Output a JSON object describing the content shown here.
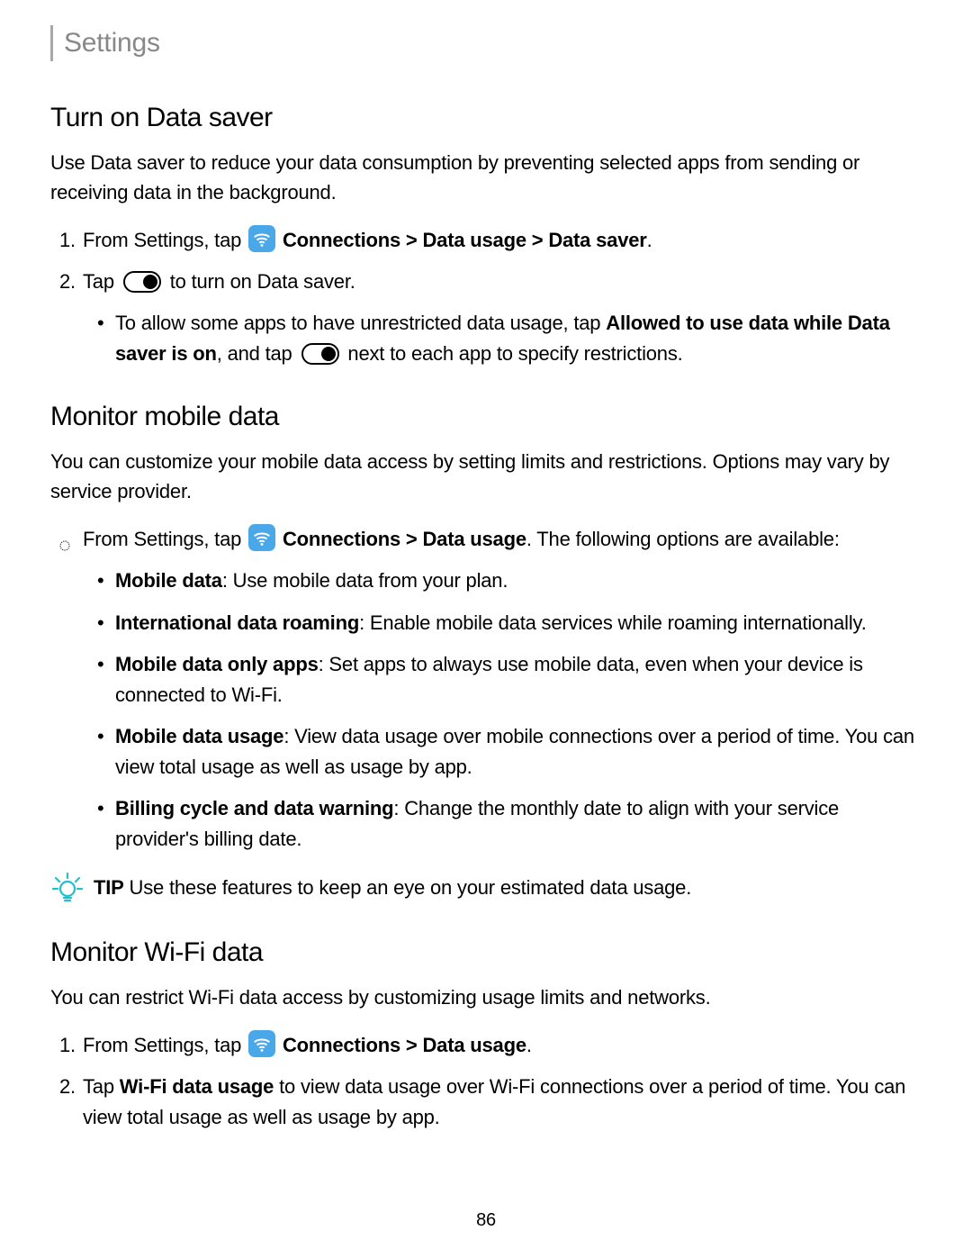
{
  "header": {
    "title": "Settings"
  },
  "page_number": "86",
  "section1": {
    "heading": "Turn on Data saver",
    "intro": "Use Data saver to reduce your data consumption by preventing selected apps from sending or receiving data in the background.",
    "step1_pre": "From Settings, tap ",
    "step1_bold": "Connections > Data usage > Data saver",
    "step1_post": ".",
    "step2_pre": "Tap ",
    "step2_post": " to turn on Data saver.",
    "sub_pre": "To allow some apps to have unrestricted data usage, tap ",
    "sub_bold1": "Allowed to use data while Data saver is on",
    "sub_mid": ", and tap ",
    "sub_end": " next to each app to specify restrictions."
  },
  "section2": {
    "heading": "Monitor mobile data",
    "intro": "You can customize your mobile data access by setting limits and restrictions. Options may vary by service provider.",
    "lead_pre": "From Settings, tap ",
    "lead_bold": "Connections > Data usage",
    "lead_post": ". The following options are available:",
    "opt1_b": "Mobile data",
    "opt1_t": ": Use mobile data from your plan.",
    "opt2_b": "International data roaming",
    "opt2_t": ": Enable mobile data services while roaming internationally.",
    "opt3_b": "Mobile data only apps",
    "opt3_t": ": Set apps to always use mobile data, even when your device is connected to Wi-Fi.",
    "opt4_b": "Mobile data usage",
    "opt4_t": ": View data usage over mobile connections over a period of time. You can view total usage as well as usage by app.",
    "opt5_b": "Billing cycle and data warning",
    "opt5_t": ": Change the monthly date to align with your service provider's billing date.",
    "tip_label": "TIP",
    "tip_text": " Use these features to keep an eye on your estimated data usage."
  },
  "section3": {
    "heading": "Monitor Wi-Fi data",
    "intro": "You can restrict Wi-Fi data access by customizing usage limits and networks.",
    "step1_pre": "From Settings, tap ",
    "step1_bold": "Connections > Data usage",
    "step1_post": ".",
    "step2_pre": "Tap ",
    "step2_bold": "Wi-Fi data usage",
    "step2_post": " to view data usage over Wi-Fi connections over a period of time. You can view total usage as well as usage by app."
  }
}
